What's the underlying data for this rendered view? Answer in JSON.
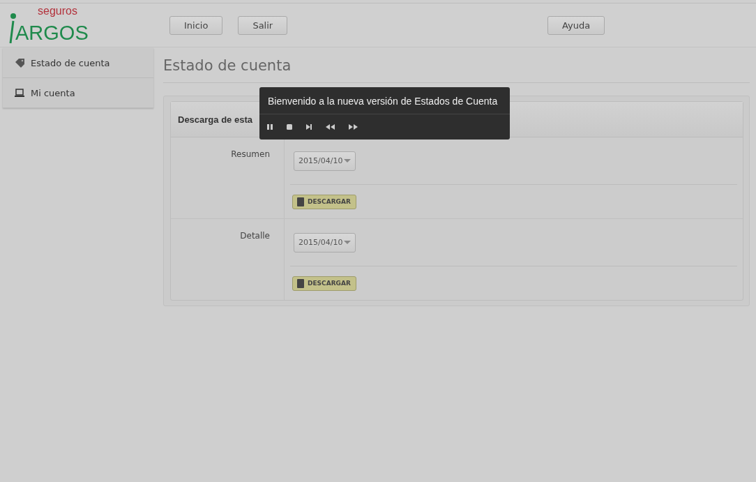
{
  "logo": {
    "top": "seguros",
    "main": "ARGOS"
  },
  "nav": [
    "Inicio",
    "Salir"
  ],
  "help": "Ayuda",
  "sidebar": {
    "items": [
      {
        "label": "Estado de cuenta"
      },
      {
        "label": "Mi cuenta"
      }
    ]
  },
  "page_title": "Estado de cuenta",
  "panel": {
    "title": "Descarga de esta",
    "rows": [
      {
        "label": "Resumen",
        "date": "2015/04/10",
        "button": "DESCARGAR"
      },
      {
        "label": "Detalle",
        "date": "2015/04/10",
        "button": "DESCARGAR"
      }
    ]
  },
  "tooltip": {
    "text": "Bienvenido a la nueva versión de Estados de Cuenta"
  }
}
